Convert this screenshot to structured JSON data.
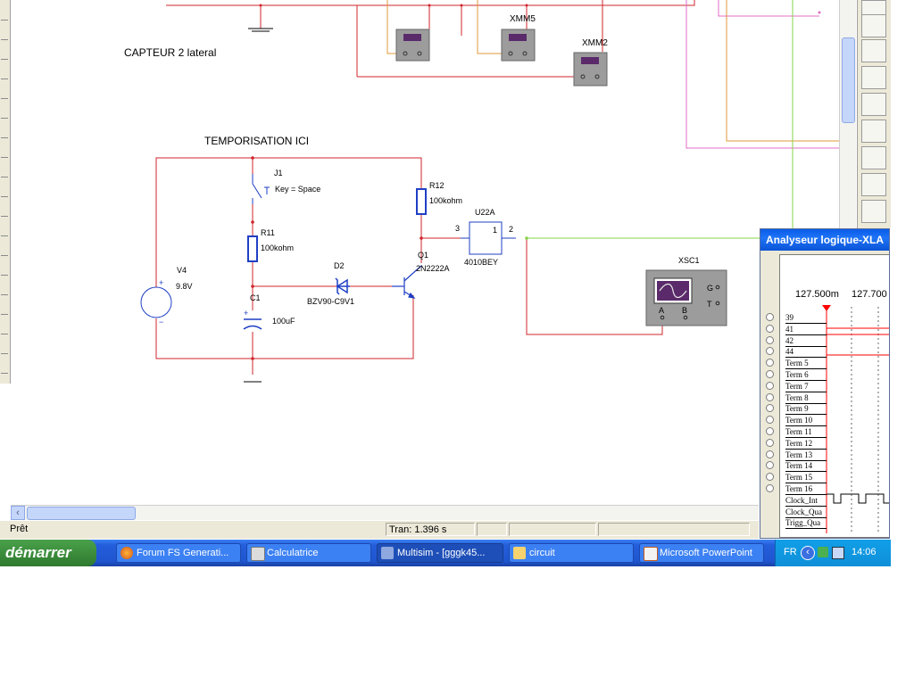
{
  "schematic": {
    "heading_capteur": "CAPTEUR 2 lateral",
    "heading_tempo": "TEMPORISATION ICI",
    "meters": [
      "XMM5",
      "XMM2"
    ],
    "v4": {
      "ref": "V4",
      "value": "9.8V"
    },
    "j1": {
      "ref": "J1",
      "value": "Key = Space"
    },
    "r11": {
      "ref": "R11",
      "value": "100kohm"
    },
    "r12": {
      "ref": "R12",
      "value": "100kohm"
    },
    "c1": {
      "ref": "C1",
      "value": "100uF"
    },
    "d2": {
      "ref": "D2",
      "value": "BZV90-C9V1"
    },
    "q1": {
      "ref": "Q1",
      "value": "2N2222A"
    },
    "u22": {
      "ref": "U22A",
      "value": "4010BEY",
      "pin_in": "3",
      "pin_out": "2",
      "gate_label": "1"
    },
    "xsc1": {
      "ref": "XSC1",
      "g": "G",
      "t": "T",
      "a": "A",
      "b": "B"
    }
  },
  "statusbar": {
    "status": "Prêt",
    "tran": "Tran: 1.396 s"
  },
  "logic_analyzer": {
    "title": "Analyseur logique-XLA",
    "time_left": "127.500m",
    "time_right": "127.700",
    "rows": [
      "39",
      "41",
      "42",
      "44",
      "Term 5",
      "Term 6",
      "Term 7",
      "Term 8",
      "Term 9",
      "Term 10",
      "Term 11",
      "Term 12",
      "Term 13",
      "Term 14",
      "Term 15",
      "Term 16",
      "Clock_Int",
      "Clock_Qua",
      "Trigg_Qua"
    ]
  },
  "taskbar": {
    "start_label": "démarrer",
    "buttons": [
      {
        "label": "Forum FS Generati...",
        "icon": "firefox-icon"
      },
      {
        "label": "Calculatrice",
        "icon": "calculator-icon"
      },
      {
        "label": "Multisim - [gggk45...",
        "icon": "multisim-icon"
      },
      {
        "label": "circuit",
        "icon": "folder-icon"
      },
      {
        "label": "Microsoft PowerPoint",
        "icon": "powerpoint-icon"
      }
    ],
    "language": "FR",
    "clock": "14:06"
  },
  "colors": {
    "wire_red": "#d0252b",
    "wire_green": "#86d44a",
    "wire_orange": "#e09a3a",
    "wire_pink": "#e06cc8",
    "component_blue": "#1f3fc4",
    "taskbar_blue": "#245edb",
    "start_green": "#3c8d3c"
  }
}
